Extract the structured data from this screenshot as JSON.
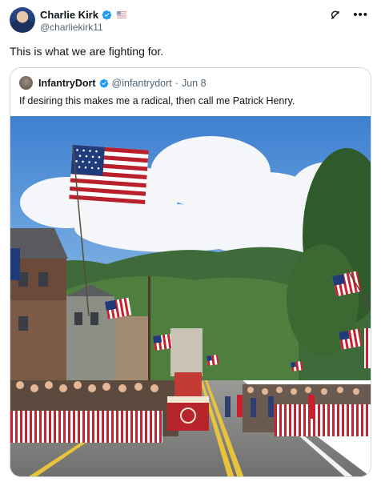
{
  "post": {
    "author_name": "Charlie Kirk",
    "author_handle": "@charliekirk11",
    "text": "This is what we are fighting for."
  },
  "quote": {
    "author_name": "InfantryDort",
    "author_handle": "@infantrydort",
    "separator": "·",
    "date": "Jun 8",
    "text": "If desiring this makes me a radical, then call me Patrick Henry."
  },
  "icons": {
    "verified": "verified-badge-icon",
    "flag": "us-flag-icon",
    "grok": "grok-icon",
    "more": "more-options-icon"
  },
  "colors": {
    "verified_blue": "#1d9bf0",
    "muted_text": "#536471",
    "border": "#cfd9de"
  }
}
